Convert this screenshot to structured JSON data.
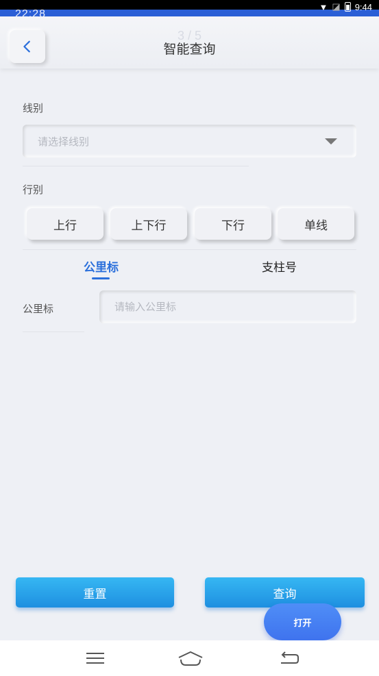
{
  "status_bar": {
    "time_background": "22:28",
    "time": "9:44"
  },
  "header": {
    "page_counter": "3 / 5",
    "title": "智能查询",
    "back_icon": "chevron-left-icon"
  },
  "form": {
    "line_label": "线别",
    "line_placeholder": "请选择线别",
    "direction_label": "行别",
    "directions": [
      "上行",
      "上下行",
      "下行",
      "单线"
    ],
    "tabs": [
      "公里标",
      "支柱号"
    ],
    "active_tab": "公里标",
    "km_label": "公里标",
    "km_placeholder": "请输入公里标"
  },
  "actions": {
    "reset": "重置",
    "query": "查询",
    "open": "打开"
  },
  "colors": {
    "accent": "#2a6fdb",
    "button_gradient_top": "#36b7f3",
    "button_gradient_bottom": "#1e8fe0",
    "background": "#eef0f5"
  }
}
